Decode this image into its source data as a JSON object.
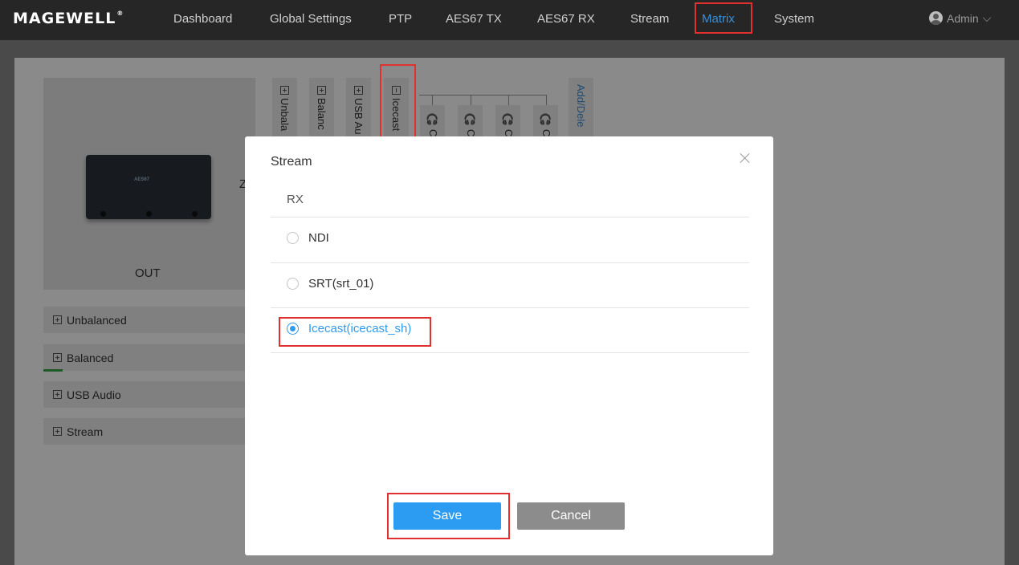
{
  "header": {
    "logo": "MAGEWELL",
    "nav": [
      "Dashboard",
      "Global Settings",
      "PTP",
      "AES67 TX",
      "AES67 RX",
      "Stream",
      "Matrix",
      "System"
    ],
    "active_nav": "Matrix",
    "user": "Admin"
  },
  "background": {
    "device_label": "AES67",
    "device_caption": "OUT",
    "groups": [
      "Unbalanced",
      "Balanced",
      "USB Audio",
      "Stream"
    ],
    "columns": [
      "Unbala",
      "Balanc",
      "USB Au",
      "Icecast"
    ],
    "sub_columns": [
      "C",
      "C",
      "C",
      "C"
    ],
    "add_delete": "Add/Dele"
  },
  "modal": {
    "title": "Stream",
    "section": "RX",
    "options": [
      "NDI",
      "SRT(srt_01)",
      "Icecast(icecast_sh)"
    ],
    "selected": "Icecast(icecast_sh)",
    "save_label": "Save",
    "cancel_label": "Cancel"
  },
  "colors": {
    "accent": "#2c9cf2",
    "highlight": "#e03030",
    "nav_bg": "#262626"
  }
}
